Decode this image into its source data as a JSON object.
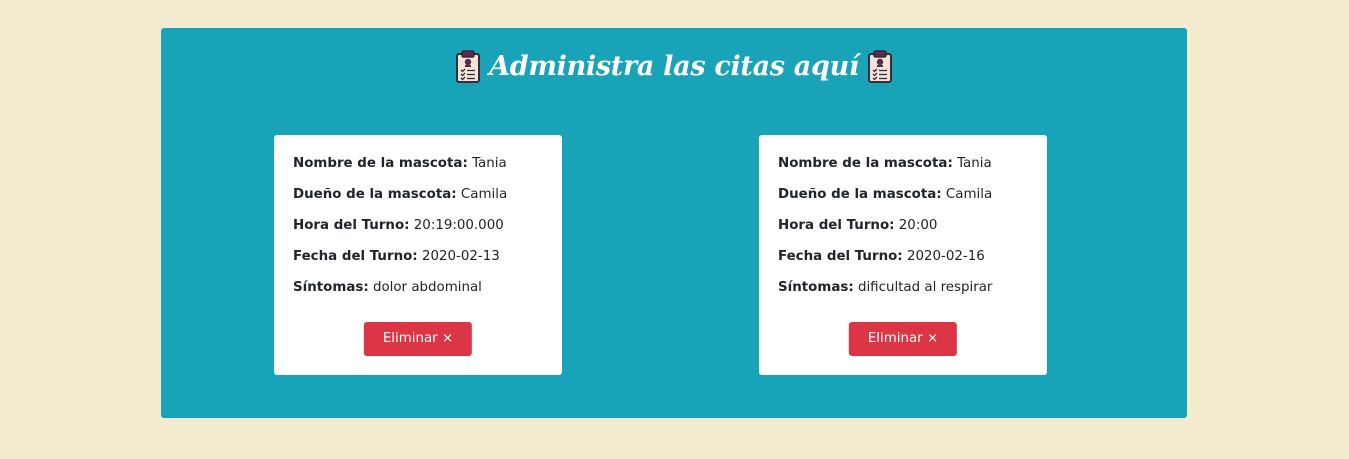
{
  "header": {
    "title": "Administra las citas aquí",
    "icon_left": "clipboard-icon",
    "icon_right": "clipboard-icon"
  },
  "colors": {
    "page_background": "#f4ecd0",
    "panel_background": "#19a3b9",
    "card_background": "#ffffff",
    "danger_button": "#dc3545"
  },
  "citas": [
    {
      "mascota_label": "Nombre de la mascota:",
      "mascota": "Tania",
      "dueno_label": "Dueño de la mascota:",
      "dueno": "Camila",
      "hora_label": "Hora del Turno:",
      "hora": "20:19:00.000",
      "fecha_label": "Fecha del Turno:",
      "fecha": "2020-02-13",
      "sintomas_label": "Síntomas:",
      "sintomas": "dolor abdominal",
      "eliminar_label": "Eliminar ×"
    },
    {
      "mascota_label": "Nombre de la mascota:",
      "mascota": "Tania",
      "dueno_label": "Dueño de la mascota:",
      "dueno": "Camila",
      "hora_label": "Hora del Turno:",
      "hora": "20:00",
      "fecha_label": "Fecha del Turno:",
      "fecha": "2020-02-16",
      "sintomas_label": "Síntomas:",
      "sintomas": "dificultad al respirar",
      "eliminar_label": "Eliminar ×"
    }
  ]
}
